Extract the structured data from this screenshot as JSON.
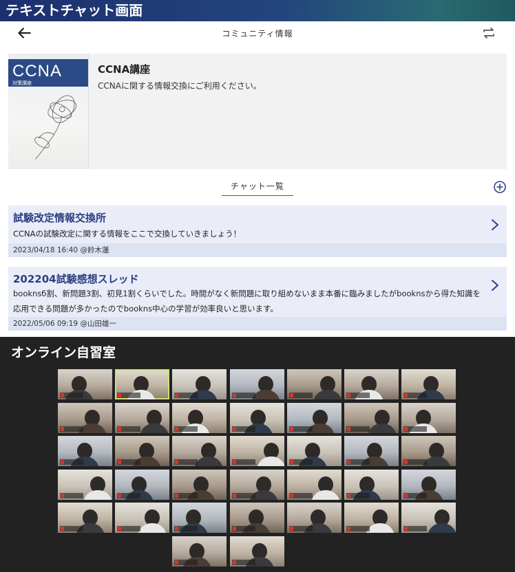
{
  "sections": {
    "text_chat_title": "テキストチャット画面",
    "online_room_title": "オンライン自習室"
  },
  "header": {
    "title": "コミュニティ情報"
  },
  "community": {
    "name": "CCNA講座",
    "description": "CCNAに関する情報交換にご利用ください。",
    "book_title": "CCNA",
    "book_subtitle": "対策講座"
  },
  "chat_list": {
    "heading": "チャット一覧"
  },
  "threads": [
    {
      "title": "試験改定情報交換所",
      "body": "CCNAの試験改定に関する情報をここで交換していきましょう！",
      "timestamp": "2023/04/18 16:40",
      "author": "@鈴木蓮"
    },
    {
      "title": "202204試験感想スレッド",
      "body": "booknsб割、新問題3割、初見1割くらいでした。時間がなく新問題に取り組めないまま本番に臨みましたがbooknsから得た知識を応用できる問題が多かったのでbookns中心の学習が効率良いと思います。",
      "timestamp": "2022/05/06 09:19",
      "author": "@山田雄一"
    }
  ],
  "colors": {
    "banner": "#1d2f6e",
    "thread_bg": "#eaedf8",
    "thread_title": "#2b3f82",
    "dark_bg": "#222222"
  },
  "video_grid": {
    "rows": [
      7,
      7,
      7,
      7,
      7,
      2
    ],
    "selected_tile": "1"
  }
}
